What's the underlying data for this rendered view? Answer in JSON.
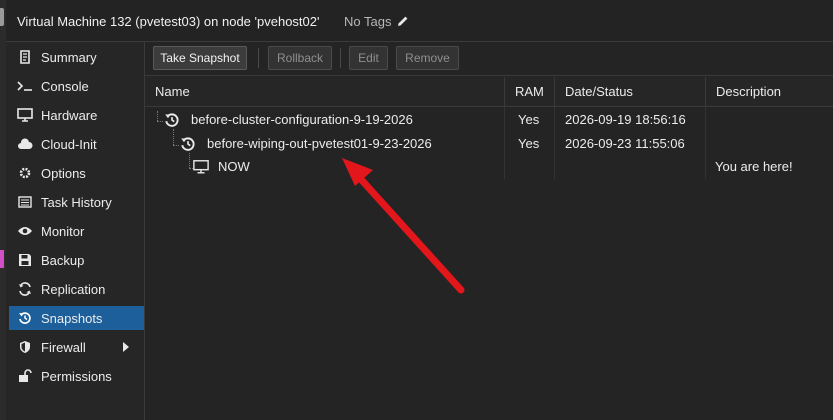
{
  "header": {
    "title": "Virtual Machine 132 (pvetest03) on node 'pvehost02'",
    "tags": "No Tags"
  },
  "sidebar": {
    "items": [
      {
        "label": "Summary",
        "icon": "summary-icon"
      },
      {
        "label": "Console",
        "icon": "console-icon"
      },
      {
        "label": "Hardware",
        "icon": "hardware-icon"
      },
      {
        "label": "Cloud-Init",
        "icon": "cloud-icon"
      },
      {
        "label": "Options",
        "icon": "gear-icon"
      },
      {
        "label": "Task History",
        "icon": "task-history-icon"
      },
      {
        "label": "Monitor",
        "icon": "eye-icon"
      },
      {
        "label": "Backup",
        "icon": "backup-icon"
      },
      {
        "label": "Replication",
        "icon": "replication-icon"
      },
      {
        "label": "Snapshots",
        "icon": "snapshot-icon",
        "active": true
      },
      {
        "label": "Firewall",
        "icon": "shield-icon",
        "has_submenu": true
      },
      {
        "label": "Permissions",
        "icon": "unlock-icon"
      }
    ]
  },
  "toolbar": {
    "take_snapshot": "Take Snapshot",
    "rollback": "Rollback",
    "edit": "Edit",
    "remove": "Remove"
  },
  "grid": {
    "columns": [
      "Name",
      "RAM",
      "Date/Status",
      "Description"
    ],
    "rows": [
      {
        "name": "before-cluster-configuration-9-19-2026",
        "ram": "Yes",
        "date": "2026-09-19 18:56:16",
        "description": "",
        "icon": "snapshot-icon",
        "level": 0
      },
      {
        "name": "before-wiping-out-pvetest01-9-23-2026",
        "ram": "Yes",
        "date": "2026-09-23 11:55:06",
        "description": "",
        "icon": "snapshot-icon",
        "level": 1
      },
      {
        "name": "NOW",
        "ram": "",
        "date": "",
        "description": "You are here!",
        "icon": "monitor-icon",
        "level": 2
      }
    ]
  },
  "annotation": {
    "color": "#e3161b",
    "icon": "red-arrow-annotation"
  },
  "colors": {
    "accent": "#1c5f9a",
    "background": "#1e1e1e"
  }
}
